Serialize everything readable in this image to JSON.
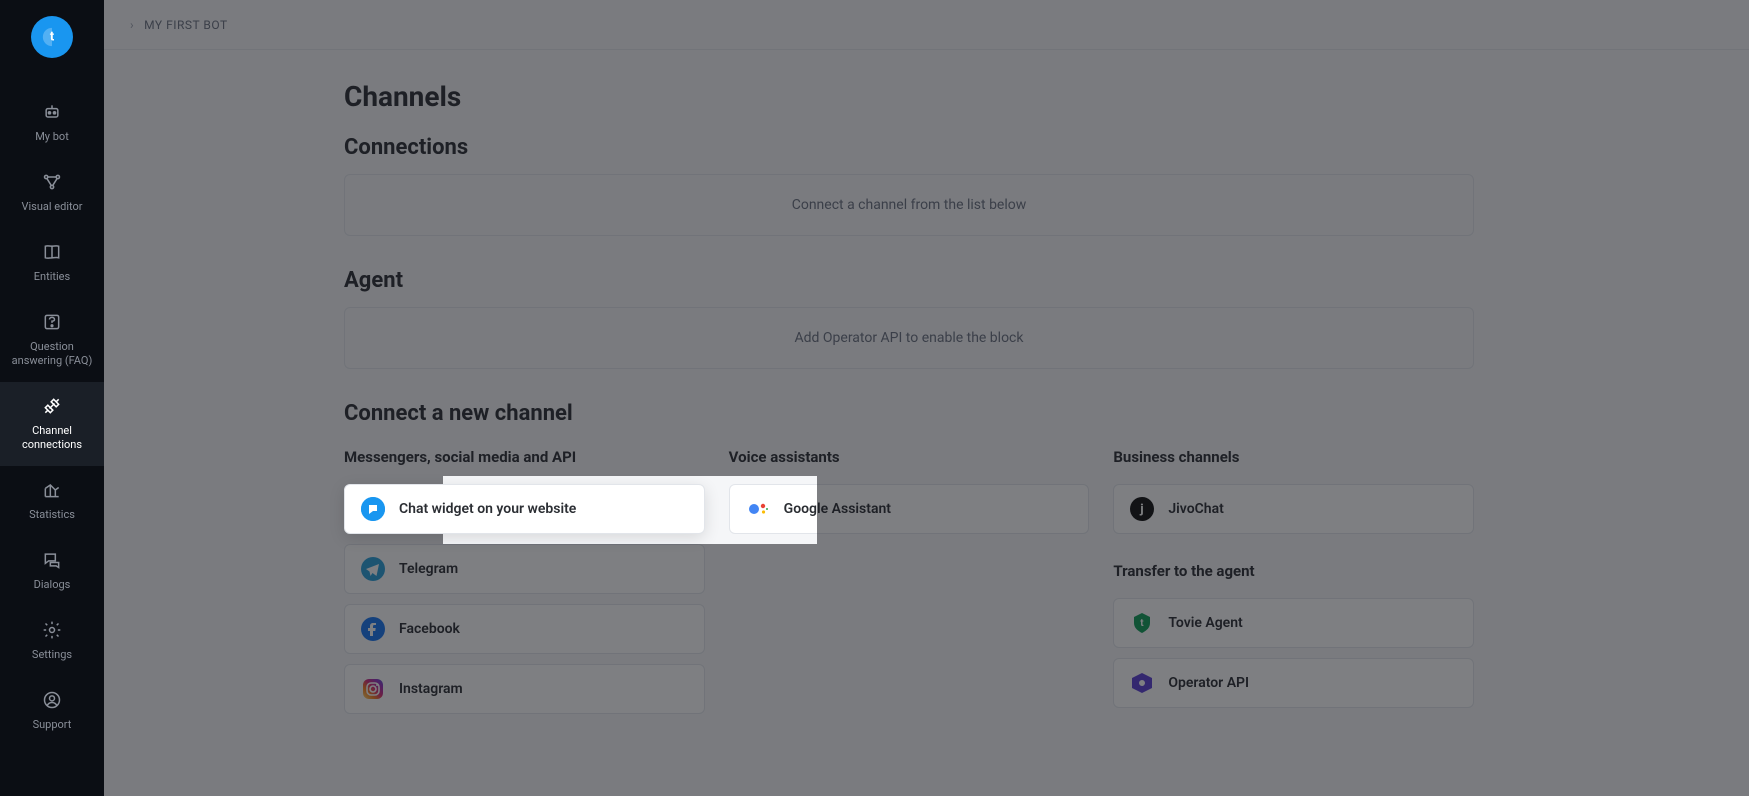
{
  "breadcrumb": {
    "text": "MY FIRST BOT"
  },
  "sidebar": {
    "items": [
      {
        "label": "My bot"
      },
      {
        "label": "Visual editor"
      },
      {
        "label": "Entities"
      },
      {
        "label": "Question answering (FAQ)"
      },
      {
        "label": "Channel connections"
      },
      {
        "label": "Statistics"
      },
      {
        "label": "Dialogs"
      },
      {
        "label": "Settings"
      },
      {
        "label": "Support"
      }
    ]
  },
  "page": {
    "title": "Channels",
    "connections": {
      "heading": "Connections",
      "empty_text": "Connect a channel from the list below"
    },
    "agent": {
      "heading": "Agent",
      "empty_text": "Add Operator API to enable the block"
    },
    "connect": {
      "heading": "Connect a new channel",
      "columns": {
        "messengers": {
          "title": "Messengers, social media and API",
          "items": [
            {
              "label": "Chat widget on your website",
              "icon": "chat-widget-icon"
            },
            {
              "label": "Telegram",
              "icon": "telegram-icon"
            },
            {
              "label": "Facebook",
              "icon": "facebook-icon"
            },
            {
              "label": "Instagram",
              "icon": "instagram-icon"
            }
          ]
        },
        "voice": {
          "title": "Voice assistants",
          "items": [
            {
              "label": "Google Assistant",
              "icon": "google-assistant-icon"
            }
          ]
        },
        "business": {
          "title": "Business channels",
          "items": [
            {
              "label": "JivoChat",
              "icon": "jivochat-icon"
            }
          ]
        },
        "transfer": {
          "title": "Transfer to the agent",
          "items": [
            {
              "label": "Tovie Agent",
              "icon": "tovie-agent-icon"
            },
            {
              "label": "Operator API",
              "icon": "operator-api-icon"
            }
          ]
        }
      }
    }
  },
  "colors": {
    "accent": "#1996f0",
    "telegram": "#29a0da",
    "facebook": "#1877f2",
    "instagram_grad": [
      "#feda75",
      "#fa7e1e",
      "#d62976",
      "#962fbf",
      "#4f5bd5"
    ],
    "jivo": "#111111",
    "tovie": "#0f9d58",
    "operator": "#5b3fd6"
  }
}
